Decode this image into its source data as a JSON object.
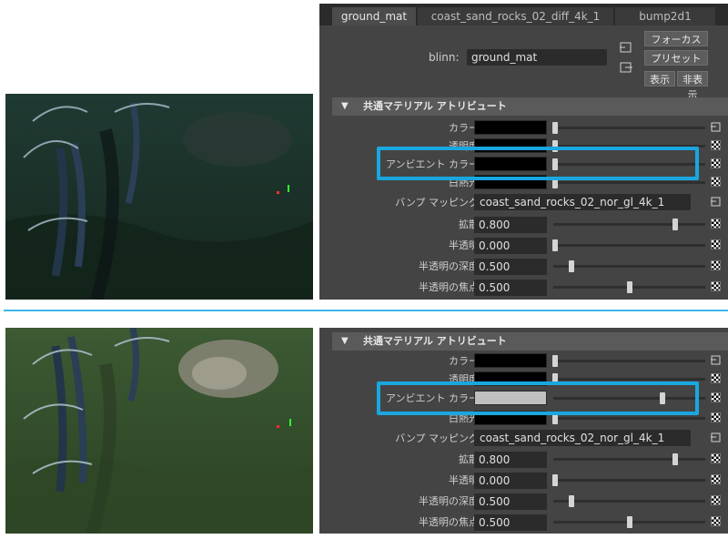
{
  "material_editor": {
    "tabs": [
      "ground_mat",
      "coast_sand_rocks_02_diff_4k_1",
      "bump2d1"
    ],
    "type_label": "blinn:",
    "material_name": "ground_mat",
    "buttons": {
      "focus": "フォーカス",
      "preset": "プリセット",
      "show": "表示",
      "hide": "非表示"
    }
  },
  "attributes_section": {
    "title": "共通マテリアル アトリビュート"
  },
  "attribute_labels": {
    "color": "カラー",
    "transparency": "透明度",
    "ambient": "アンビエント カラー",
    "incandescence": "白熱光",
    "bump": "バンプ マッピング",
    "diffuse": "拡散",
    "translucence": "半透明",
    "translucence_depth": "半透明の深度",
    "translucence_focus": "半透明の焦点"
  },
  "before": {
    "ambient_color": "#000000",
    "ambient_level": 0.0,
    "bump_texture": "coast_sand_rocks_02_nor_gl_4k_1",
    "diffuse": "0.800",
    "translucence": "0.000",
    "translucence_depth": "0.500",
    "translucence_focus": "0.500"
  },
  "after": {
    "ambient_color": "#c0c0c0",
    "ambient_level": 0.72,
    "bump_texture": "coast_sand_rocks_02_nor_gl_4k_1",
    "diffuse": "0.800",
    "translucence": "0.000",
    "translucence_depth": "0.500",
    "translucence_focus": "0.500"
  },
  "colors": {
    "highlight": "#1aa7e0",
    "panel_bg": "#444444",
    "field_bg": "#2b2b2b"
  }
}
